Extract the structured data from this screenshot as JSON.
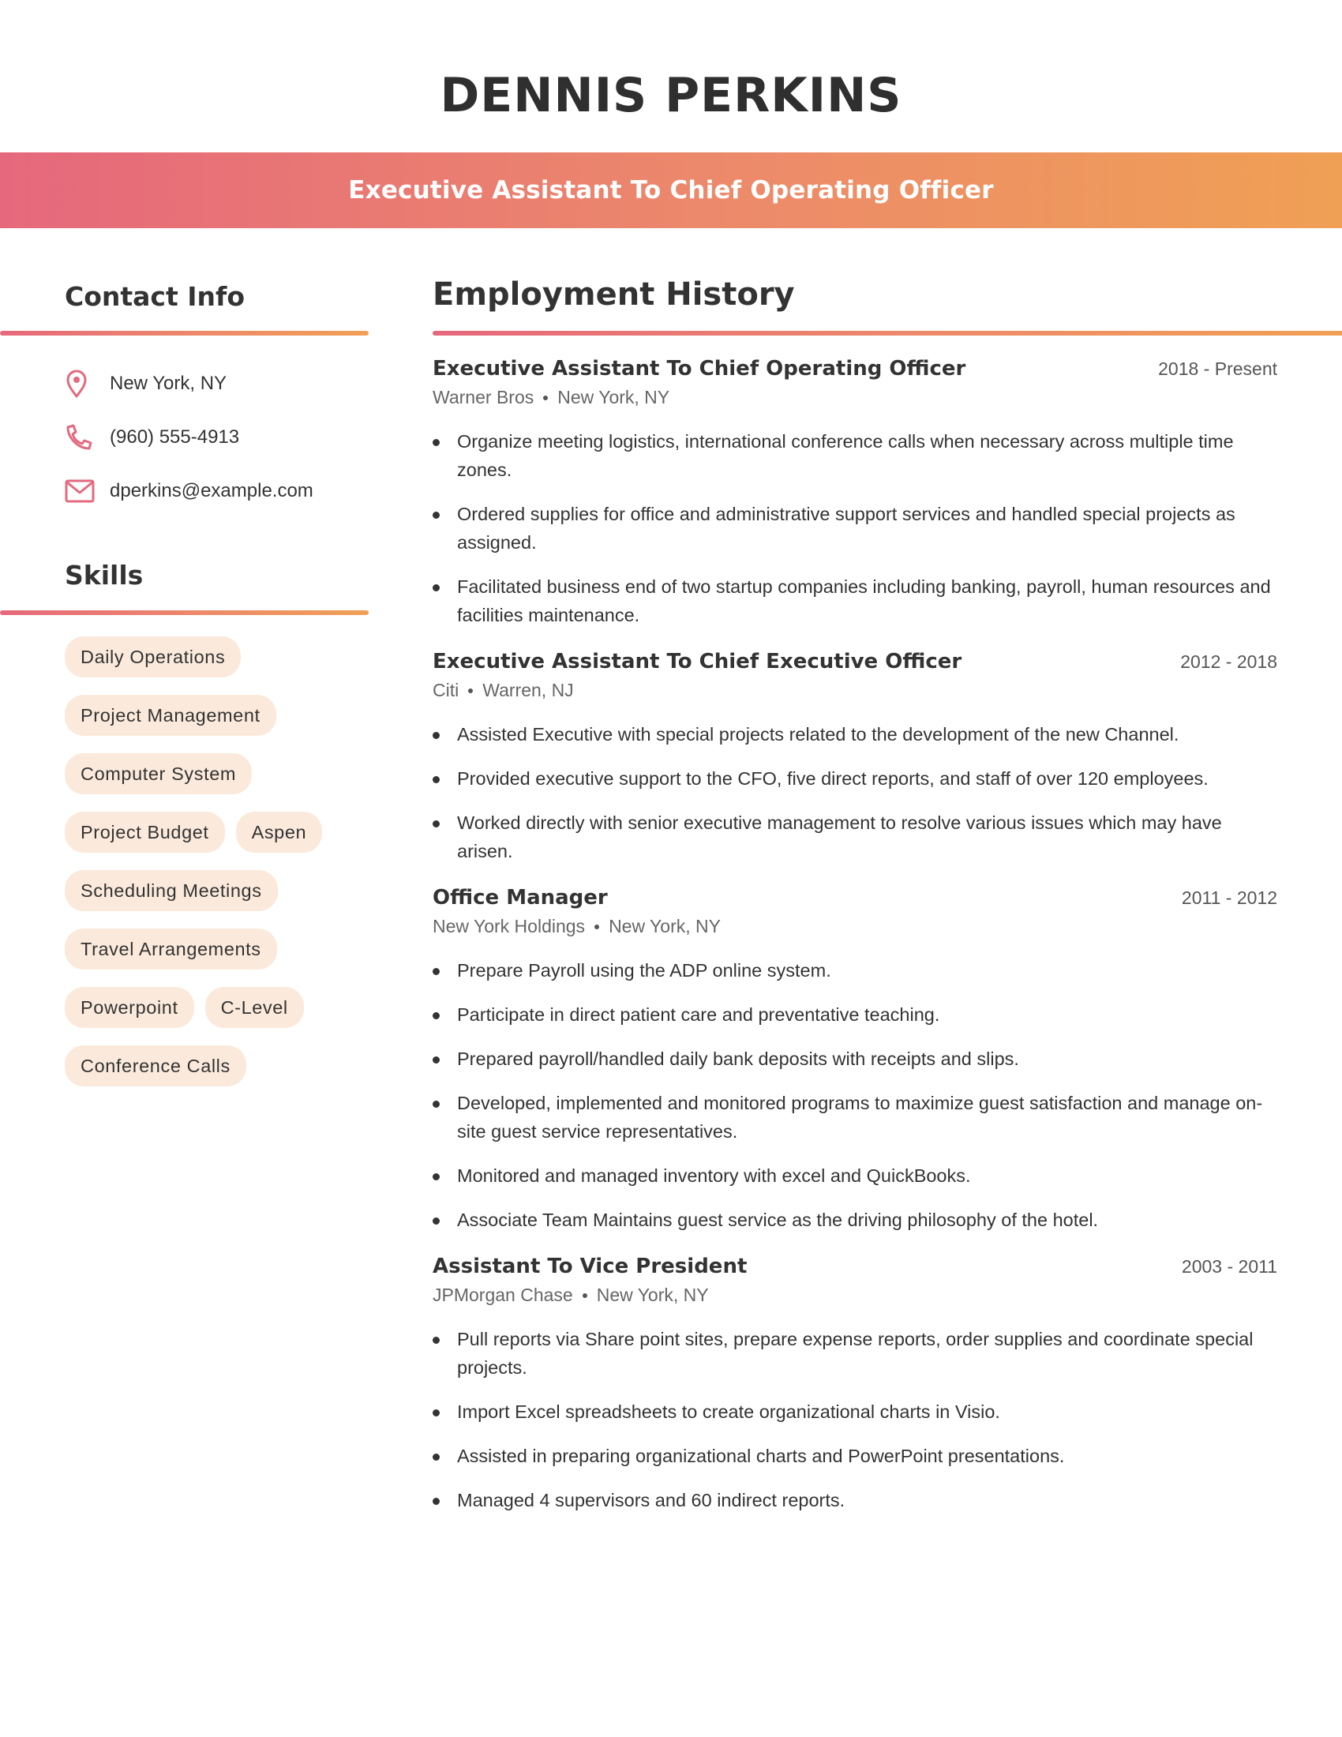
{
  "header": {
    "name": "DENNIS PERKINS",
    "job_title": "Executive Assistant To Chief Operating Officer"
  },
  "colors": {
    "accent_start": "#e6687c",
    "accent_end": "#f0a055",
    "pill_bg": "#fbeadb",
    "icon_color": "#e36a7f"
  },
  "contact": {
    "title": "Contact Info",
    "items": [
      {
        "icon": "location-pin-icon",
        "text": "New York, NY"
      },
      {
        "icon": "phone-icon",
        "text": "(960) 555-4913"
      },
      {
        "icon": "mail-icon",
        "text": "dperkins@example.com"
      }
    ]
  },
  "skills": {
    "title": "Skills",
    "items": [
      "Daily Operations",
      "Project Management",
      "Computer System",
      "Project Budget",
      "Aspen",
      "Scheduling Meetings",
      "Travel Arrangements",
      "Powerpoint",
      "C-Level",
      "Conference Calls"
    ]
  },
  "employment": {
    "title": "Employment History",
    "jobs": [
      {
        "title": "Executive Assistant To Chief Operating Officer",
        "dates": "2018 - Present",
        "company": "Warner Bros",
        "location": "New York, NY",
        "bullets": [
          "Organize meeting logistics, international conference calls when necessary across multiple time zones.",
          "Ordered supplies for office and administrative support services and handled special projects as assigned.",
          "Facilitated business end of two startup companies including banking, payroll, human resources and facilities maintenance."
        ]
      },
      {
        "title": "Executive Assistant To Chief Executive Officer",
        "dates": "2012 - 2018",
        "company": "Citi",
        "location": "Warren, NJ",
        "bullets": [
          "Assisted Executive with special projects related to the development of the new Channel.",
          "Provided executive support to the CFO, five direct reports, and staff of over 120 employees.",
          "Worked directly with senior executive management to resolve various issues which may have arisen."
        ]
      },
      {
        "title": "Office Manager",
        "dates": "2011 - 2012",
        "company": "New York Holdings",
        "location": "New York, NY",
        "bullets": [
          "Prepare Payroll using the ADP online system.",
          "Participate in direct patient care and preventative teaching.",
          "Prepared payroll/handled daily bank deposits with receipts and slips.",
          "Developed, implemented and monitored programs to maximize guest satisfaction and manage on-site guest service representatives.",
          "Monitored and managed inventory with excel and QuickBooks.",
          "Associate Team Maintains guest service as the driving philosophy of the hotel."
        ]
      },
      {
        "title": "Assistant To Vice President",
        "dates": "2003 - 2011",
        "company": "JPMorgan Chase",
        "location": "New York, NY",
        "bullets": [
          "Pull reports via Share point sites, prepare expense reports, order supplies and coordinate special projects.",
          "Import Excel spreadsheets to create organizational charts in Visio.",
          "Assisted in preparing organizational charts and PowerPoint presentations.",
          "Managed 4 supervisors and 60 indirect reports."
        ]
      }
    ]
  }
}
